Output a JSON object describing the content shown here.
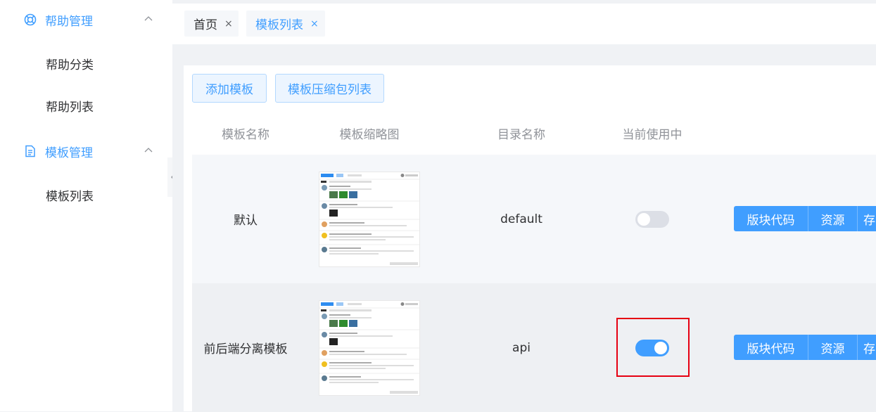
{
  "sidebar": {
    "groups": [
      {
        "title": "帮助管理",
        "icon": "lifebuoy-icon",
        "items": [
          "帮助分类",
          "帮助列表"
        ]
      },
      {
        "title": "模板管理",
        "icon": "document-icon",
        "items": [
          "模板列表"
        ]
      }
    ]
  },
  "tabs": [
    {
      "label": "首页",
      "close": "×"
    },
    {
      "label": "模板列表",
      "close": "×"
    }
  ],
  "toolbar": {
    "add_label": "添加模板",
    "zip_label": "模板压缩包列表"
  },
  "table": {
    "columns": [
      "模板名称",
      "模板缩略图",
      "目录名称",
      "当前使用中"
    ],
    "rows": [
      {
        "name": "默认",
        "dir": "default",
        "in_use": false,
        "ops": [
          "版块代码",
          "资源",
          "存"
        ]
      },
      {
        "name": "前后端分离模板",
        "dir": "api",
        "in_use": true,
        "ops": [
          "版块代码",
          "资源",
          "存"
        ]
      }
    ]
  },
  "colors": {
    "accent": "#409eff",
    "highlight_box": "#e60012"
  }
}
